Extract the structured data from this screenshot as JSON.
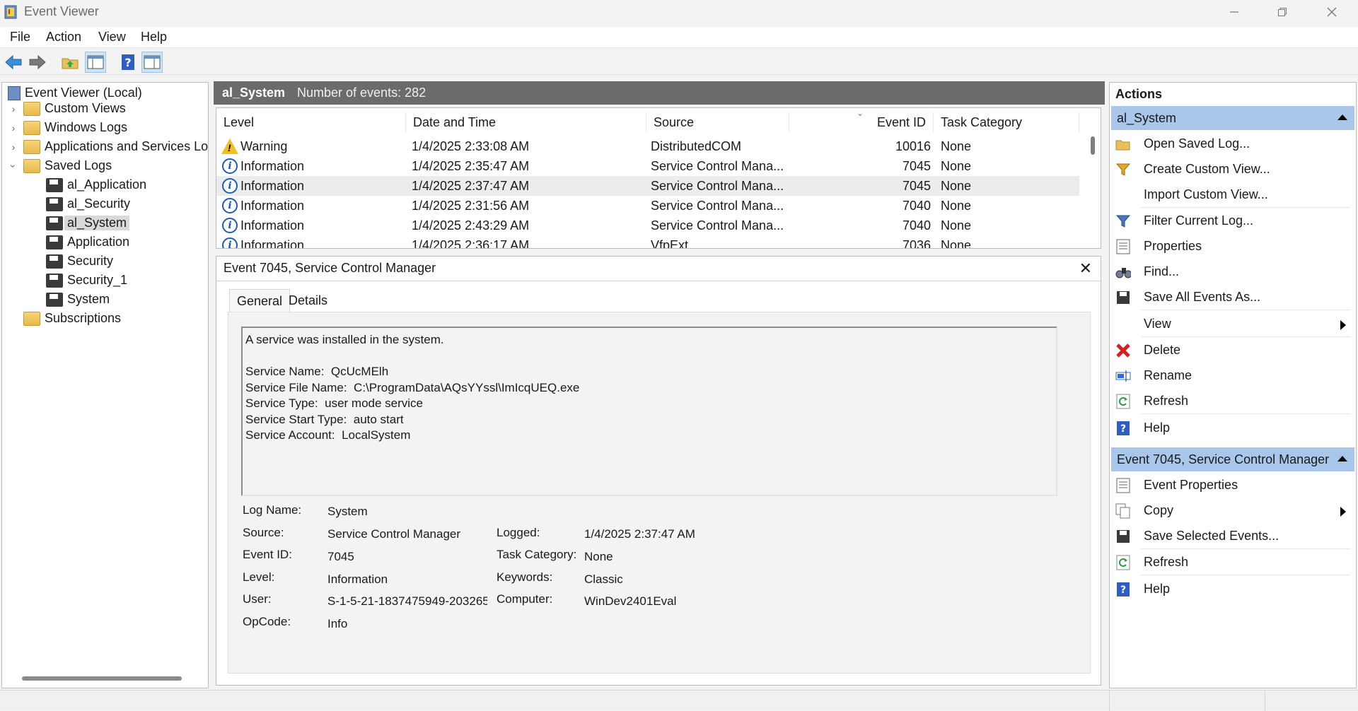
{
  "window": {
    "title": "Event Viewer"
  },
  "menu": [
    "File",
    "Action",
    "View",
    "Help"
  ],
  "tree": {
    "root": "Event Viewer (Local)",
    "items": [
      {
        "label": "Custom Views",
        "expandable": true
      },
      {
        "label": "Windows Logs",
        "expandable": true
      },
      {
        "label": "Applications and Services Log",
        "expandable": true
      },
      {
        "label": "Saved Logs",
        "expanded": true
      },
      {
        "label": "al_Application"
      },
      {
        "label": "al_Security"
      },
      {
        "label": "al_System",
        "selected": true
      },
      {
        "label": "Application"
      },
      {
        "label": "Security"
      },
      {
        "label": "Security_1"
      },
      {
        "label": "System"
      },
      {
        "label": "Subscriptions"
      }
    ]
  },
  "log": {
    "name": "al_System",
    "count_text": "Number of events: 282"
  },
  "columns": {
    "level": "Level",
    "datetime": "Date and Time",
    "source": "Source",
    "event_id": "Event ID",
    "task": "Task Category"
  },
  "events": [
    {
      "level": "Warning",
      "datetime": "1/4/2025 2:33:08 AM",
      "source": "DistributedCOM",
      "event_id": "10016",
      "task": "None"
    },
    {
      "level": "Information",
      "datetime": "1/4/2025 2:35:47 AM",
      "source": "Service Control Mana...",
      "event_id": "7045",
      "task": "None"
    },
    {
      "level": "Information",
      "datetime": "1/4/2025 2:37:47 AM",
      "source": "Service Control Mana...",
      "event_id": "7045",
      "task": "None"
    },
    {
      "level": "Information",
      "datetime": "1/4/2025 2:31:56 AM",
      "source": "Service Control Mana...",
      "event_id": "7040",
      "task": "None"
    },
    {
      "level": "Information",
      "datetime": "1/4/2025 2:43:29 AM",
      "source": "Service Control Mana...",
      "event_id": "7040",
      "task": "None"
    },
    {
      "level": "Information",
      "datetime": "1/4/2025 2:36:17 AM",
      "source": "VfpExt",
      "event_id": "7036",
      "task": "None"
    }
  ],
  "detail": {
    "title": "Event 7045, Service Control Manager",
    "tabs": [
      "General",
      "Details"
    ],
    "description": "A service was installed in the system.\n\nService Name:  QcUcMElh\nService File Name:  C:\\ProgramData\\AQsYYssl\\ImIcqUEQ.exe\nService Type:  user mode service\nService Start Type:  auto start\nService Account:  LocalSystem",
    "fields": {
      "log_name_label": "Log Name:",
      "log_name": "System",
      "source_label": "Source:",
      "source": "Service Control Manager",
      "logged_label": "Logged:",
      "logged": "1/4/2025 2:37:47 AM",
      "event_id_label": "Event ID:",
      "event_id": "7045",
      "task_label": "Task Category:",
      "task": "None",
      "level_label": "Level:",
      "level": "Information",
      "keywords_label": "Keywords:",
      "keywords": "Classic",
      "user_label": "User:",
      "user": "S-1-5-21-1837475949-203265",
      "computer_label": "Computer:",
      "computer": "WinDev2401Eval",
      "opcode_label": "OpCode:",
      "opcode": "Info"
    }
  },
  "actions": {
    "header": "Actions",
    "section1": "al_System",
    "section1_items": [
      "Open Saved Log...",
      "Create Custom View...",
      "Import Custom View...",
      "Filter Current Log...",
      "Properties",
      "Find...",
      "Save All Events As...",
      "View",
      "Delete",
      "Rename",
      "Refresh",
      "Help"
    ],
    "section2": "Event 7045, Service Control Manager",
    "section2_items": [
      "Event Properties",
      "Copy",
      "Save Selected Events...",
      "Refresh",
      "Help"
    ]
  },
  "colors": {
    "section_bg": "#a9c7ea",
    "header_bg": "#6b6b6b",
    "info_blue": "#1e5bb8",
    "warning_yellow": "#f0c020",
    "delete_red": "#d32020"
  }
}
